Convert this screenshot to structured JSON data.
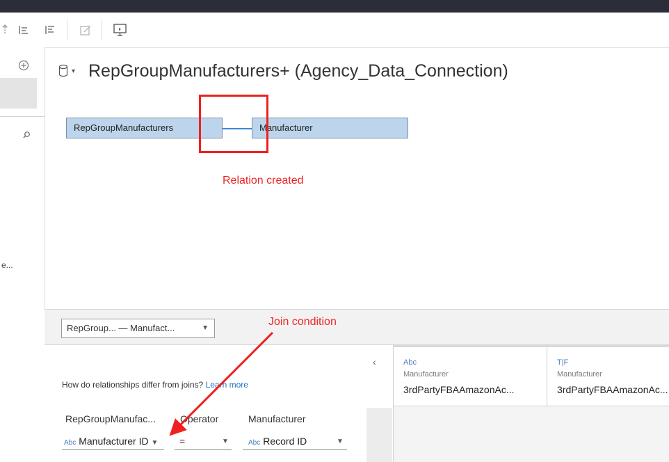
{
  "header": {
    "title": "RepGroupManufacturers+ (Agency_Data_Connection)",
    "datasource_icon": "database-icon"
  },
  "toolbar": {
    "icons": [
      "sort-ascending-icon",
      "sort-descending-icon",
      "annotate-icon",
      "presentation-icon"
    ]
  },
  "canvas": {
    "left_table": "RepGroupManufacturers",
    "right_table": "Manufacturer",
    "annotation_relation": "Relation created",
    "annotation_join": "Join condition"
  },
  "left_rail": {
    "truncated_text": "e..."
  },
  "relationship": {
    "selector_value": "RepGroup...  — Manufact...",
    "help_text": "How do relationships differ from joins?",
    "learn_more": "Learn more",
    "collapse_glyph": "‹",
    "columns": {
      "left": "RepGroupManufac...",
      "operator": "Operator",
      "right": "Manufacturer"
    },
    "condition": {
      "left_type": "Abc",
      "left_field": "Manufacturer ID",
      "operator": "=",
      "right_type": "Abc",
      "right_field": "Record ID"
    }
  },
  "preview": {
    "columns": [
      {
        "type": "Abc",
        "source": "Manufacturer",
        "name": "3rdPartyFBAAmazonAc..."
      },
      {
        "type": "T|F",
        "source": "Manufacturer",
        "name": "3rdPartyFBAAmazonAc..."
      }
    ]
  },
  "colors": {
    "table_fill": "#bcd5ec",
    "relation_line": "#3d88d4",
    "annotation_red": "#ee2020",
    "link_blue": "#1f6fc5"
  }
}
